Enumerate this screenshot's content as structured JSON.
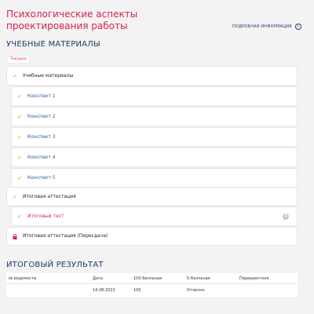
{
  "course": {
    "title": "Психологические аспекты проектирования работы",
    "more_info_label": "ПОДРОБНАЯ ИНФОРМАЦИЯ",
    "info_icon_glyph": "i"
  },
  "materials": {
    "heading": "УЧЕБНЫЕ МАТЕРИАЛЫ",
    "current_badge": "Текущее",
    "items": [
      {
        "label": "Учебные материалы",
        "status": "done",
        "level": "parent"
      },
      {
        "label": "Конспект 1",
        "status": "done",
        "level": "child"
      },
      {
        "label": "Конспект 2",
        "status": "done",
        "level": "child"
      },
      {
        "label": "Конспект 3",
        "status": "done",
        "level": "child"
      },
      {
        "label": "Конспект 4",
        "status": "done",
        "level": "child"
      },
      {
        "label": "Конспект 5",
        "status": "done",
        "level": "child"
      },
      {
        "label": "Итоговая аттестация",
        "status": "done",
        "level": "parent"
      },
      {
        "label": "Итоговый тест",
        "status": "done",
        "level": "child"
      },
      {
        "label": "Итоговая аттестация (Пересдача)",
        "status": "locked",
        "level": "parent"
      }
    ],
    "check_glyph": "✓",
    "help_glyph": "?"
  },
  "results": {
    "heading": "ИТОГОВЫЙ РЕЗУЛЬТАТ",
    "columns": [
      "№ ведомости",
      "Дата",
      "100-балльная",
      "5-балльная",
      "Перекрестное"
    ],
    "rows": [
      [
        "",
        "14.08.2023",
        "100",
        "Отлично",
        ""
      ]
    ]
  },
  "colors": {
    "accent_red": "#d8234a",
    "heading_blue": "#1f3c6b",
    "link_blue": "#2a5a9c",
    "check_green": "#8bb82a"
  }
}
